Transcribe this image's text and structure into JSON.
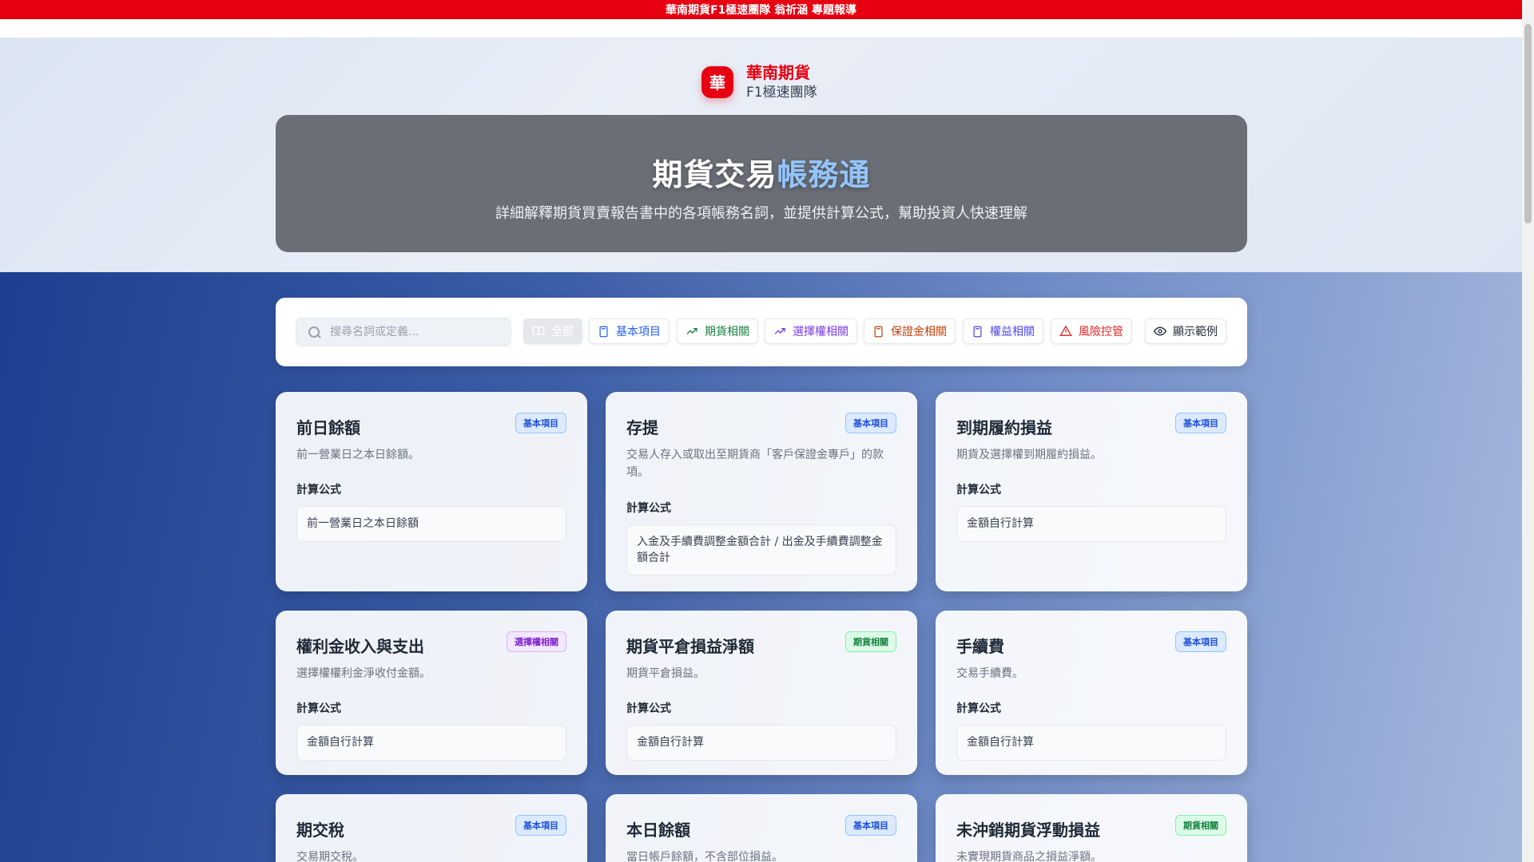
{
  "banner": "華南期貨F1極速團隊 翁祈涵 專題報導",
  "brand": {
    "logo": "華",
    "name": "華南期貨",
    "sub": "F1極速團隊"
  },
  "hero": {
    "title_main": "期貨交易",
    "title_accent": "帳務通",
    "desc": "詳細解釋期貨買賣報告書中的各項帳務名詞，並提供計算公式，幫助投資人快速理解"
  },
  "filter": {
    "search_placeholder": "搜尋名詞或定義...",
    "chips": {
      "all": "全部",
      "basic": "基本項目",
      "futures": "期貨相關",
      "options": "選擇權相關",
      "margin": "保證金相關",
      "equity": "權益相關",
      "risk": "風險控管",
      "show_examples": "顯示範例"
    }
  },
  "formula_label": "計算公式",
  "cards": [
    {
      "title": "前日餘額",
      "badge": "基本項目",
      "desc": "前一營業日之本日餘額。",
      "formula": "前一營業日之本日餘額"
    },
    {
      "title": "存提",
      "badge": "基本項目",
      "desc": "交易人存入或取出至期貨商「客戶保證金專戶」的款項。",
      "formula": "入金及手續費調整金額合計 / 出金及手續費調整金額合計"
    },
    {
      "title": "到期履約損益",
      "badge": "基本項目",
      "desc": "期貨及選擇權到期履約損益。",
      "formula": "金額自行計算"
    },
    {
      "title": "權利金收入與支出",
      "badge": "選擇權相關",
      "desc": "選擇權權利金淨收付金額。",
      "formula": "金額自行計算"
    },
    {
      "title": "期貨平倉損益淨額",
      "badge": "期貨相關",
      "desc": "期貨平倉損益。",
      "formula": "金額自行計算"
    },
    {
      "title": "手續費",
      "badge": "基本項目",
      "desc": "交易手續費。",
      "formula": "金額自行計算"
    },
    {
      "title": "期交稅",
      "badge": "基本項目",
      "desc": "交易期交稅。"
    },
    {
      "title": "本日餘額",
      "badge": "基本項目",
      "desc": "當日帳戶餘額，不含部位損益。"
    },
    {
      "title": "未沖銷期貨浮動損益",
      "badge": "期貨相關",
      "desc": "未實現期貨商品之損益淨額。"
    }
  ]
}
